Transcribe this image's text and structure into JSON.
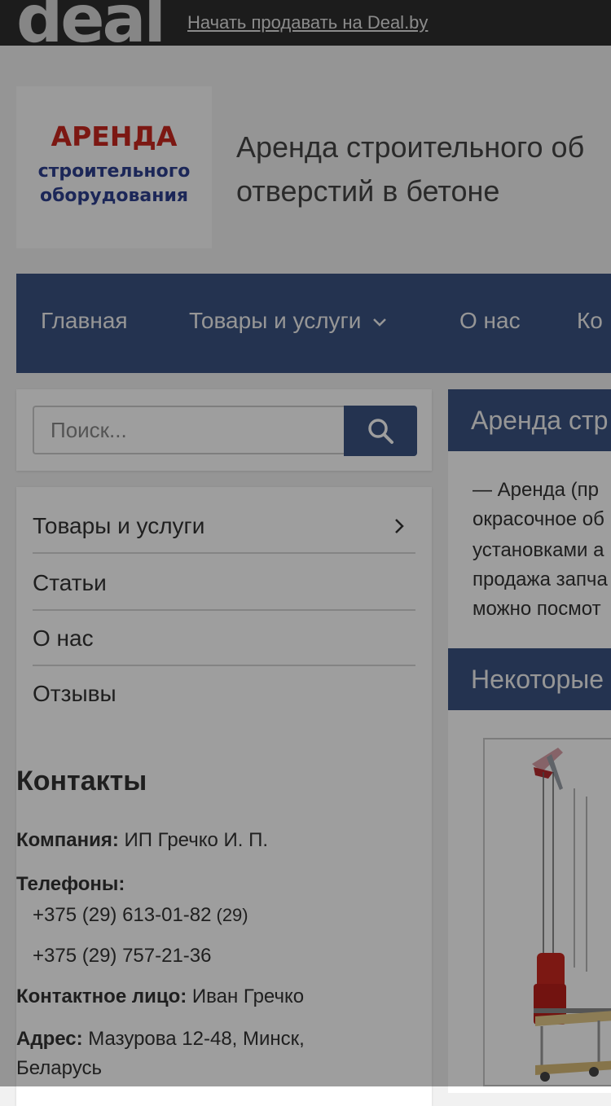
{
  "topbar": {
    "logo_text": "deal",
    "sell_link": "Начать продавать на Deal.by"
  },
  "header": {
    "logo": {
      "line1": "АРЕНДА",
      "line2": "строительного",
      "line3": "оборудования"
    },
    "title_line1": "Аренда строительного об",
    "title_line2": "отверстий в бетоне"
  },
  "nav": {
    "items": [
      {
        "label": "Главная"
      },
      {
        "label": "Товары и услуги"
      },
      {
        "label": "О нас"
      },
      {
        "label": "Ко"
      }
    ]
  },
  "search": {
    "placeholder": "Поиск..."
  },
  "sidebar": {
    "menu": [
      {
        "label": "Товары и услуги"
      },
      {
        "label": "Статьи"
      },
      {
        "label": "О нас"
      },
      {
        "label": "Отзывы"
      }
    ],
    "contacts": {
      "title": "Контакты",
      "company_label": "Компания:",
      "company_value": "ИП Гречко И. П.",
      "phones_label": "Телефоны:",
      "phone1": "+375 (29) 613-01-82",
      "phone1_suffix": "(29)",
      "phone2": "+375 (29) 757-21-36",
      "person_label": "Контактное лицо:",
      "person_value": "Иван Гречко",
      "address_label": "Адрес:",
      "address_value": "Мазурова 12-48, Минск, Беларусь"
    }
  },
  "content": {
    "section1_title": "Аренда стр",
    "lines": [
      "— Аренда (пр",
      "окрасочное об",
      "установками а",
      "продажа запча",
      "можно посмот"
    ],
    "section2_title": "Некоторые"
  },
  "colors": {
    "nav_bg": "#3a5381",
    "topbar_bg": "#2e2e2e",
    "logo_red": "#c8281f",
    "logo_blue": "#2e3f8f"
  }
}
